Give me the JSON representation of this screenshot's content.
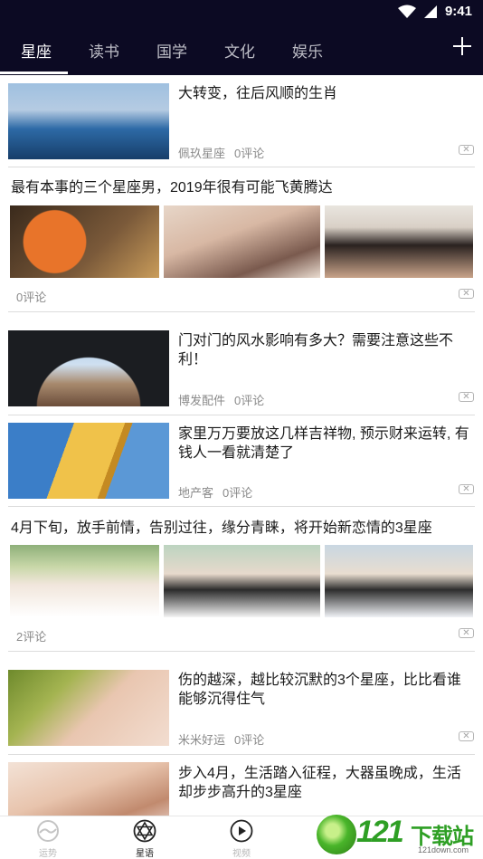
{
  "status_bar": {
    "time": "9:41"
  },
  "tabs": [
    {
      "label": "星座",
      "active": true
    },
    {
      "label": "读书",
      "active": false
    },
    {
      "label": "国学",
      "active": false
    },
    {
      "label": "文化",
      "active": false
    },
    {
      "label": "娱乐",
      "active": false
    }
  ],
  "feed": {
    "items": [
      {
        "title": "大转变，往后风顺的生肖",
        "source": "佩玖星座",
        "comments": "0评论"
      },
      {
        "title": "最有本事的三个星座男，2019年很有可能飞黄腾达",
        "comments": "0评论"
      },
      {
        "title": "门对门的风水影响有多大？需要注意这些不利！",
        "source": "博发配件",
        "comments": "0评论"
      },
      {
        "title": "家里万万要放这几样吉祥物, 预示财来运转, 有钱人一看就清楚了",
        "source": "地产客",
        "comments": "0评论"
      },
      {
        "title": "4月下旬，放手前情，告别过往，缘分青睐，将开始新恋情的3星座",
        "comments": "2评论"
      },
      {
        "title": "伤的越深，越比较沉默的3个星座，比比看谁能够沉得住气",
        "source": "米米好运",
        "comments": "0评论"
      },
      {
        "title": "步入4月，生活踏入征程，大器虽晚成，生活却步步高升的3星座"
      }
    ]
  },
  "bottom_nav": [
    {
      "label": "运势",
      "icon": "fortune-icon",
      "active": false
    },
    {
      "label": "星语",
      "icon": "star-of-david-icon",
      "active": true
    },
    {
      "label": "视频",
      "icon": "play-icon",
      "active": false
    }
  ],
  "watermark": {
    "number": "121",
    "text": "下载站",
    "url": "121down.com"
  },
  "colors": {
    "header_bg": "#0c0a23",
    "tab_active": "#ffffff",
    "tab_inactive": "#bdbdc6",
    "watermark_green": "#2e9f24"
  }
}
